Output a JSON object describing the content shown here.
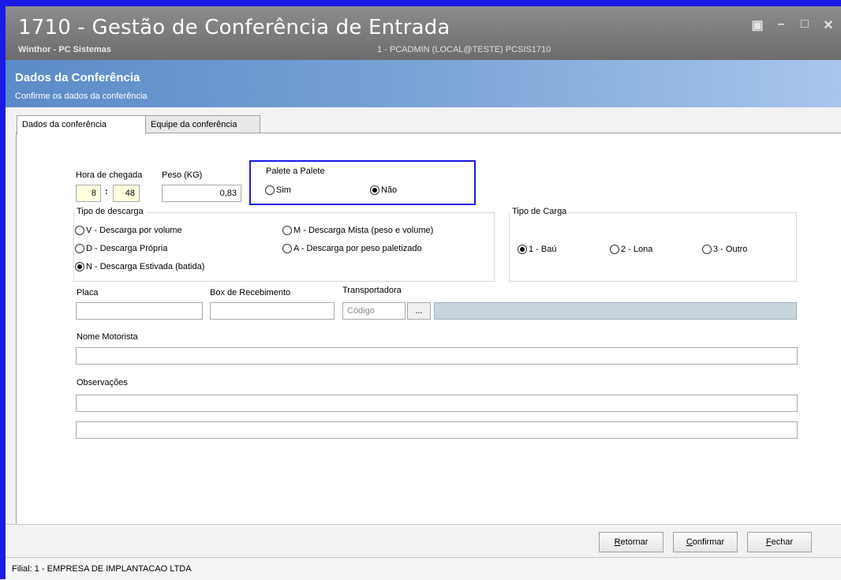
{
  "window": {
    "title": "1710 - Gestão de Conferência de Entrada",
    "subtitle": "Winthor - PC Sistemas",
    "user_info": "1 - PCADMIN (LOCAL@TESTE)   PCSIS1710",
    "controls": [
      "restore-icon",
      "minimize-icon",
      "maximize-icon",
      "close-icon"
    ]
  },
  "header": {
    "title": "Dados da Conferência",
    "subtitle": "Confirme os dados da conferência"
  },
  "tabs": [
    {
      "label": "Dados da conferência",
      "active": true
    },
    {
      "label": "Equipe da conferência",
      "active": false
    }
  ],
  "form": {
    "hora_label": "Hora de chegada",
    "hora_h": "8",
    "hora_sep": ":",
    "hora_m": "48",
    "peso_label": "Peso (KG)",
    "peso_value": "0,83",
    "palete": {
      "title": "Palete a Palete",
      "options": [
        {
          "label": "Sim",
          "selected": false
        },
        {
          "label": "Não",
          "selected": true
        }
      ]
    },
    "tipo_descarga": {
      "title": "Tipo de descarga",
      "options": [
        {
          "label": "V - Descarga por volume",
          "selected": false
        },
        {
          "label": "M - Descarga Mista (peso e volume)",
          "selected": false
        },
        {
          "label": "D - Descarga Própria",
          "selected": false
        },
        {
          "label": "A - Descarga por peso paletizado",
          "selected": false
        },
        {
          "label": "N - Descarga Estivada (batida)",
          "selected": true
        }
      ]
    },
    "tipo_carga": {
      "title": "Tipo de Carga",
      "options": [
        {
          "label": "1 - Baú",
          "selected": true
        },
        {
          "label": "2 - Lona",
          "selected": false
        },
        {
          "label": "3 - Outro",
          "selected": false
        }
      ]
    },
    "placa_label": "Placa",
    "placa_value": "",
    "box_label": "Box de Recebimento",
    "box_value": "",
    "transp_label": "Transportadora",
    "transp_codigo_placeholder": "Código",
    "transp_button": "...",
    "motorista_label": "Nome Motorista",
    "motorista_value": "",
    "observacoes_label": "Observações",
    "obs1_value": "",
    "obs2_value": ""
  },
  "buttons": {
    "retornar": {
      "first": "R",
      "rest": "etornar"
    },
    "confirmar": {
      "first": "C",
      "rest": "onfirmar"
    },
    "fechar": {
      "first": "F",
      "rest": "echar"
    }
  },
  "status": {
    "filial": "Filial: 1 - EMPRESA DE IMPLANTACAO LTDA"
  },
  "colors": {
    "frame": "#1a1ae6",
    "header_gradient_start": "#5b8bc8",
    "header_gradient_end": "#a8c6ec",
    "highlight": "#1a1ae6",
    "hour_field_bg": "#ffffe0"
  }
}
